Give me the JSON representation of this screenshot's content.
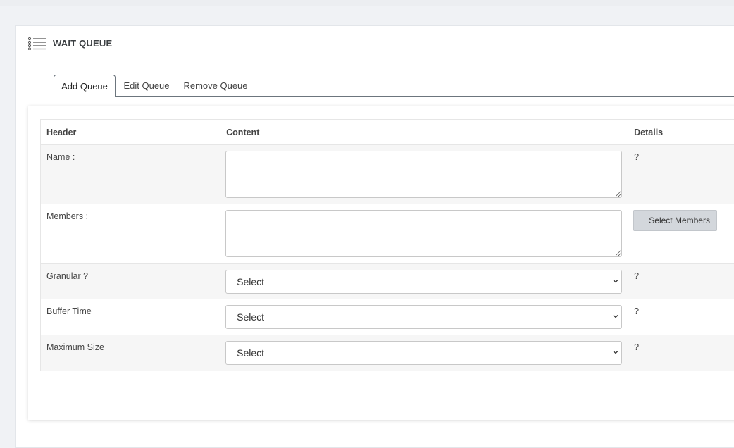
{
  "page": {
    "title": "WAIT QUEUE"
  },
  "tabs": [
    {
      "label": "Add Queue",
      "active": true
    },
    {
      "label": "Edit Queue",
      "active": false
    },
    {
      "label": "Remove Queue",
      "active": false
    }
  ],
  "table": {
    "columns": [
      "Header",
      "Content",
      "Details"
    ],
    "rows": [
      {
        "header": "Name :",
        "field": "textarea",
        "value": "",
        "details": "?"
      },
      {
        "header": "Members :",
        "field": "textarea",
        "value": "",
        "details_button": "Select Members"
      },
      {
        "header": "Granular ?",
        "field": "select",
        "selected": "Select",
        "details": "?"
      },
      {
        "header": "Buffer Time",
        "field": "select",
        "selected": "Select",
        "details": "?"
      },
      {
        "header": "Maximum Size",
        "field": "select",
        "selected": "Select",
        "details": "?"
      }
    ]
  },
  "icons": {
    "header_icon": "list-icon",
    "select_arrow": "chevron-down-icon"
  },
  "colors": {
    "background": "#f0f2f5",
    "card": "#ffffff",
    "button": "#d3d7dc",
    "row_stripe": "#f6f6f6"
  }
}
